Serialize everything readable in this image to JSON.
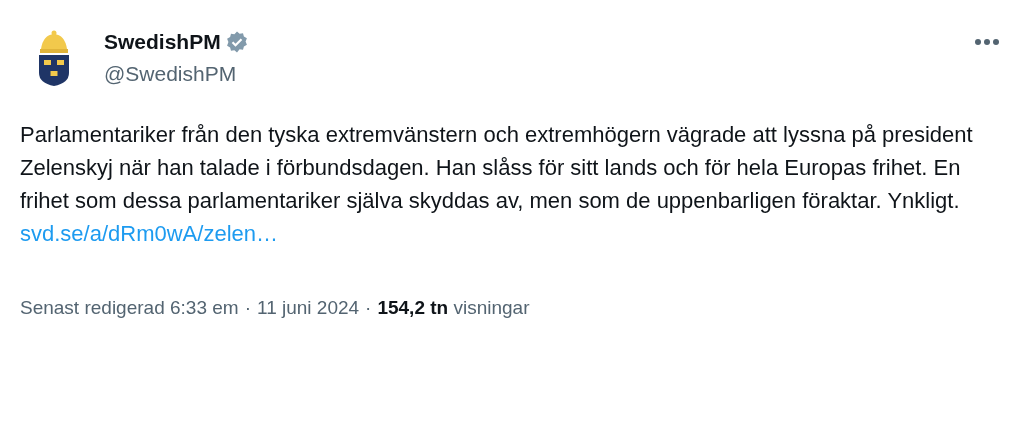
{
  "author": {
    "name": "SwedishPM",
    "handle": "@SwedishPM",
    "verified": true
  },
  "body": "Parlamentariker från den tyska extremvänstern och extremhögern vägrade att lyssna på president Zelenskyj när han talade i förbundsdagen. Han slåss för sitt lands och för hela Europas frihet. En frihet som dessa parlamentariker själva skyddas av, men som de uppenbarligen föraktar. Ynkligt.",
  "link": "svd.se/a/dRm0wA/zelen…",
  "meta": {
    "edited": "Senast redigerad 6:33 em",
    "separator_1": "·",
    "date": "11 juni 2024",
    "separator_2": "·",
    "views": "**154,2 tn** visningar"
  }
}
